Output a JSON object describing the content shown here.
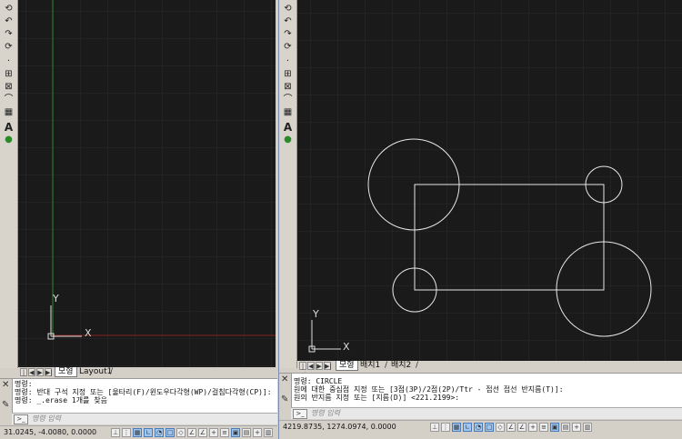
{
  "left_window": {
    "tabs": [
      {
        "label": "모형",
        "active": true
      },
      {
        "label": "Layout1",
        "active": false
      }
    ],
    "tab_separator": "/",
    "ucs": {
      "x_label": "X",
      "y_label": "Y"
    },
    "command_history": [
      "명령:",
      "명령: 반대 구석 지정 또는 [울타리(F)/윈도우다각형(WP)/걸침다각형(CP)]:",
      "명령: _.erase 1개를 찾음"
    ],
    "command_placeholder": "명령 입력",
    "coordinates": "31.0245, -4.0080, 0.0000"
  },
  "right_window": {
    "tabs": [
      {
        "label": "모형",
        "active": true
      },
      {
        "label": "배치1",
        "active": false
      },
      {
        "label": "배치2",
        "active": false
      }
    ],
    "tab_separator": "/",
    "ucs": {
      "x_label": "X",
      "y_label": "Y"
    },
    "command_history": [
      "명령:  CIRCLE",
      "원에 대한 중심점 지정 또는 [3점(3P)/2점(2P)/Ttr - 접선 접선 반지름(T)]:",
      "원의 반지름 지정 또는 [지름(D)] <221.2199>:"
    ],
    "command_placeholder": "명령 입력",
    "coordinates": "4219.8735, 1274.0974, 0.0000"
  },
  "toolbar_icons": [
    "orbit-icon",
    "undo-arc-icon",
    "redo-arc-icon",
    "rotate-icon",
    "rotate-copy-icon",
    "point-icon",
    "scale-icon",
    "stretch-icon",
    "chamfer-icon",
    "table-icon",
    "table-grid-icon",
    "text-icon",
    "attribute-icon"
  ],
  "colors": {
    "viewport_bg": "#1a1a1a",
    "grid_minor": "#262626",
    "grid_major": "#2f2f2f",
    "y_axis": "#2e8b2e",
    "x_axis": "#8b2020",
    "geometry": "#e6e6e6",
    "chrome": "#d4d0c8"
  }
}
